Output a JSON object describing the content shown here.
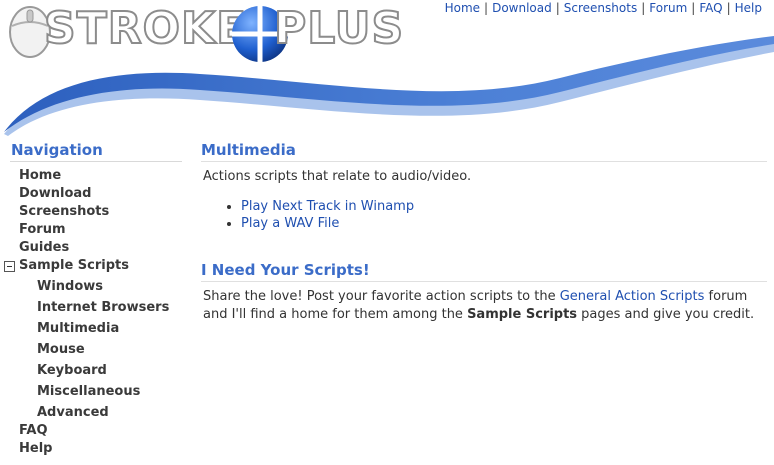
{
  "header": {
    "logo_text_a": "STROKES",
    "logo_text_b": "PLUS",
    "top_nav": [
      "Home",
      "Download",
      "Screenshots",
      "Forum",
      "FAQ",
      "Help"
    ]
  },
  "sidebar": {
    "title": "Navigation",
    "items": [
      "Home",
      "Download",
      "Screenshots",
      "Forum",
      "Guides"
    ],
    "sample_scripts": {
      "label": "Sample Scripts",
      "children": [
        "Windows",
        "Internet Browsers",
        "Multimedia",
        "Mouse",
        "Keyboard",
        "Miscellaneous",
        "Advanced"
      ]
    },
    "bottom_items": [
      "FAQ",
      "Help"
    ]
  },
  "main": {
    "section1": {
      "title": "Multimedia",
      "description": "Actions scripts that relate to audio/video.",
      "links": [
        "Play Next Track in Winamp",
        "Play a WAV File"
      ]
    },
    "section2": {
      "title": "I Need Your Scripts!",
      "text_before_link": "Share the love! Post your favorite action scripts to the ",
      "link": "General Action Scripts",
      "text_after_link": " forum and I'll find a home for them among the ",
      "bold": "Sample Scripts",
      "text_end": " pages and give you credit."
    }
  },
  "colors": {
    "accent_blue": "#3b6cc8",
    "link_blue": "#1f4fb0",
    "swoosh_dark": "#2f63c2",
    "swoosh_light": "#9dbbe8"
  },
  "icons": [
    "mouse-icon",
    "globe-icon",
    "collapse-toggle-icon"
  ]
}
